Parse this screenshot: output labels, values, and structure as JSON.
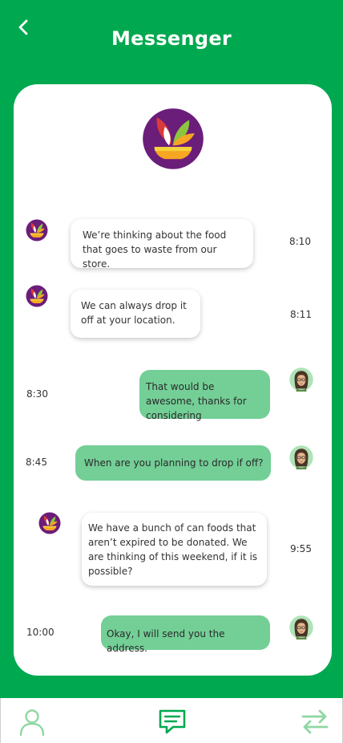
{
  "header": {
    "title": "Messenger",
    "back_icon": "chevron-left-icon"
  },
  "colors": {
    "brand_green": "#00a84f",
    "outgoing_bubble": "#73cf96",
    "logo_purple": "#6b1d7a"
  },
  "messages": [
    {
      "sender": "store",
      "text": "We’re thinking about the food that goes to waste from our store.",
      "time": "8:10"
    },
    {
      "sender": "store",
      "text": "We can always drop it off at your location.",
      "time": "8:11"
    },
    {
      "sender": "user",
      "text": "That would be awesome, thanks for considering",
      "time": "8:30"
    },
    {
      "sender": "user",
      "text": "When are you planning to drop if off?",
      "time": "8:45"
    },
    {
      "sender": "store",
      "text": "We have a bunch of can foods that aren’t expired to be donated. We are thinking of this weekend, if it is possible?",
      "time": "9:55"
    },
    {
      "sender": "user",
      "text": "Okay, I will send you the address.",
      "time": "10:00"
    }
  ],
  "nav": {
    "items": [
      {
        "icon": "profile-icon"
      },
      {
        "icon": "chat-icon",
        "active": true
      },
      {
        "icon": "swap-arrows-icon"
      }
    ]
  }
}
